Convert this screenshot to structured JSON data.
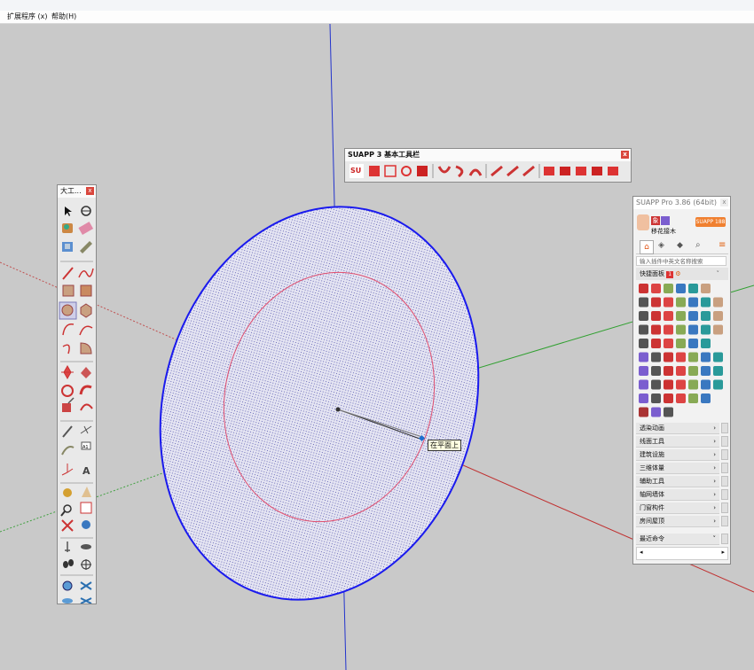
{
  "menu": {
    "items": [
      "扩展程序 (x)",
      "帮助(H)"
    ]
  },
  "viewport": {
    "tooltip": "在平面上"
  },
  "large_toolbar": {
    "title": "大工..."
  },
  "suapp_toolbar": {
    "title": "SUAPP 3 基本工具栏",
    "su_icon": "SU"
  },
  "suapp_panel": {
    "title": "SUAPP Pro 3.86 (64bit)",
    "badge": "SUAPP 188",
    "avatar_label": "象",
    "username": "移花接木",
    "search_placeholder": "输入插件中英文名称搜索",
    "quick_panel_label": "快捷面板",
    "quick_badge": "1",
    "categories": [
      "透染动画",
      "线面工具",
      "建筑设施",
      "三维体量",
      "辅助工具",
      "轴网墙体",
      "门窗构件",
      "房间屋顶"
    ],
    "recent_label": "最近命令"
  },
  "colors": {
    "accent_blue": "#1a1aff",
    "red_axis": "#c0392b",
    "green_axis": "#2fa52f",
    "ellipse_fill": "#dcdcf0",
    "suapp_orange": "#f08030"
  }
}
